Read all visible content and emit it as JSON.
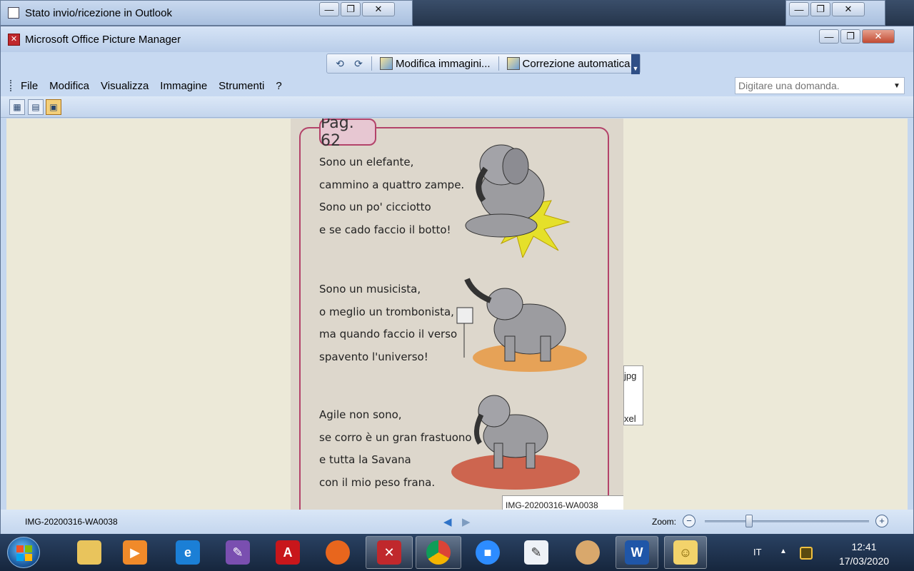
{
  "background_window": {
    "title": "Stato invio/ricezione in Outlook",
    "minimize": "—",
    "restore": "❐",
    "close": "✕"
  },
  "window": {
    "title": "Microsoft Office Picture Manager",
    "minimize": "—",
    "restore": "❐",
    "close": "✕"
  },
  "image_toolbar": {
    "edit_pictures_label": "Modifica immagini...",
    "auto_correct_label": "Correzione automatica"
  },
  "menu": [
    "File",
    "Modifica",
    "Visualizza",
    "Immagine",
    "Strumenti",
    "?"
  ],
  "help_box": {
    "placeholder": "Digitare una domanda."
  },
  "picture": {
    "page_label": "Pag. 62",
    "stanzas": [
      [
        "Sono un elefante,",
        "cammino a quattro zampe.",
        "Sono un po' cicciotto",
        "e se cado faccio il botto!"
      ],
      [
        "Sono un musicista,",
        "o meglio un trombonista,",
        "ma quando faccio il verso",
        "spavento l'universo!"
      ],
      [
        "Agile non sono,",
        "se corro è un gran frastuono",
        "e tutta la Savana",
        "con il mio peso frana."
      ]
    ]
  },
  "tooltip_partial": {
    "line1": "jpg",
    "line2": "xel"
  },
  "caption_partial": "IMG-20200316-WA0038",
  "status": {
    "filename": "IMG-20200316-WA0038",
    "zoom_label": "Zoom:",
    "zoom_level": 0.27
  },
  "taskbar": {
    "language": "IT",
    "time": "12:41",
    "date": "17/03/2020",
    "apps": [
      "file-explorer",
      "media-player",
      "internet-explorer",
      "paint-app",
      "adobe-reader",
      "firefox",
      "picture-manager",
      "chrome",
      "zoom",
      "whiteboard-app",
      "paint-palette",
      "word",
      "outlook-sticky-notes"
    ]
  }
}
